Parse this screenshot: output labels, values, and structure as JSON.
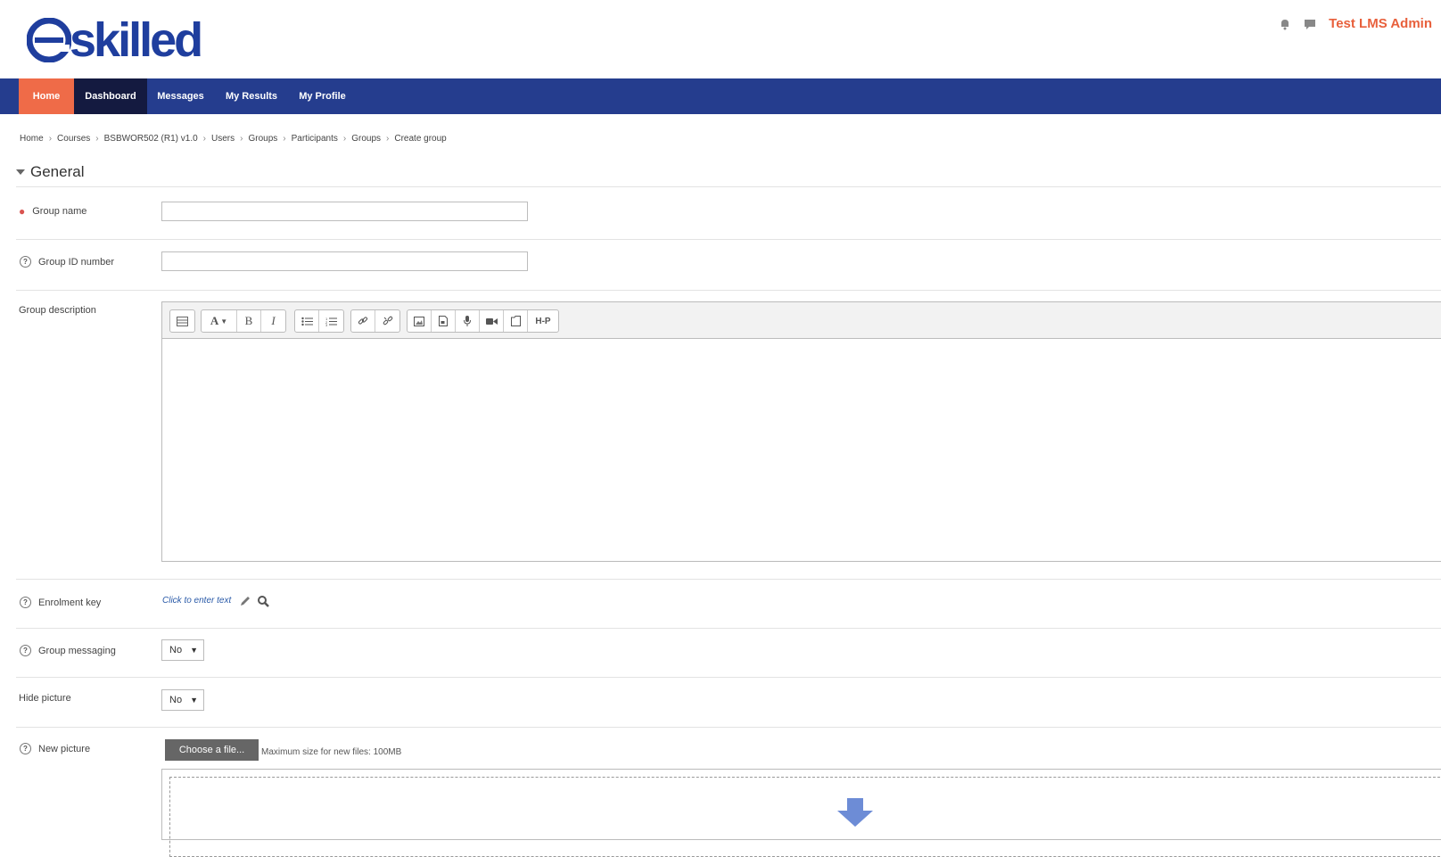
{
  "brand": {
    "logo_text": "skilled",
    "logo_letter": "e",
    "color": "#1f3e9e"
  },
  "header": {
    "user_name": "Test LMS Admin",
    "accent": "#e8603c"
  },
  "nav": {
    "items": [
      {
        "label": "Home",
        "active": true
      },
      {
        "label": "Dashboard"
      },
      {
        "label": "Messages"
      },
      {
        "label": "My Results"
      },
      {
        "label": "My Profile"
      }
    ],
    "bg": "#253d8e"
  },
  "breadcrumb": [
    "Home",
    "Courses",
    "BSBWOR502 (R1) v1.0",
    "Users",
    "Groups",
    "Participants",
    "Groups",
    "Create group"
  ],
  "section": {
    "title": "General"
  },
  "form": {
    "group_name": {
      "label": "Group name",
      "value": ""
    },
    "group_id": {
      "label": "Group ID number",
      "value": ""
    },
    "group_description": {
      "label": "Group description"
    },
    "enrolment_key": {
      "label": "Enrolment key",
      "link": "Click to enter text"
    },
    "group_messaging": {
      "label": "Group messaging",
      "value": "No"
    },
    "hide_picture": {
      "label": "Hide picture",
      "value": "No"
    },
    "new_picture": {
      "label": "New picture",
      "button": "Choose a file...",
      "max_size": "Maximum size for new files: 100MB"
    }
  },
  "editor_toolbar": {
    "buttons": [
      "toggle-toolbar-icon",
      "font-size-icon",
      "bold-icon",
      "italic-icon",
      "unordered-list-icon",
      "ordered-list-icon",
      "link-icon",
      "unlink-icon",
      "image-icon",
      "media-icon",
      "record-audio-icon",
      "record-video-icon",
      "manage-files-icon",
      "h5p-icon"
    ],
    "labels": {
      "bold": "B",
      "italic": "I",
      "font": "A",
      "h5p": "H-P"
    }
  }
}
